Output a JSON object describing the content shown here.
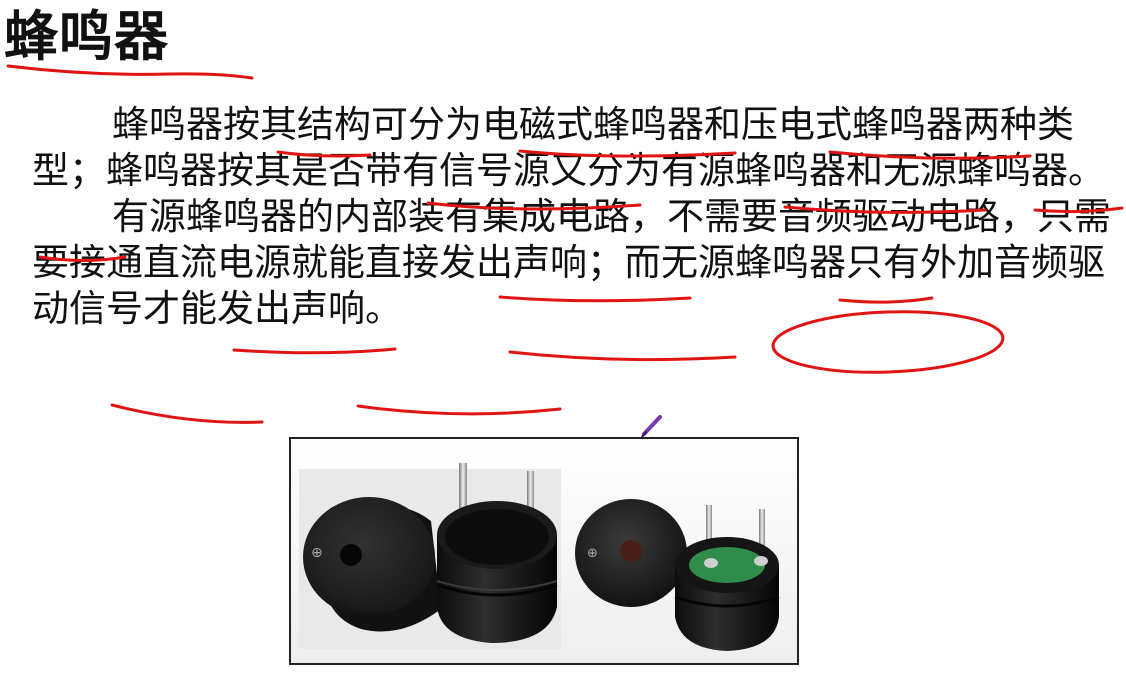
{
  "slide": {
    "title": "蜂鸣器",
    "paragraphs": [
      "蜂鸣器按其结构可分为电磁式蜂鸣器和压电式蜂鸣器两种类型；蜂鸣器按其是否带有信号源又分为有源蜂鸣器和无源蜂鸣器。",
      "有源蜂鸣器的内部装有集成电路，不需要音频驱动电路，只需要接通直流电源就能直接发出声响；而无源蜂鸣器只有外加音频驱动信号才能发出声响。"
    ],
    "annotation_color": "#e11414",
    "image": {
      "icon": "buzzer-photo-icon",
      "symbol": "⊕"
    }
  }
}
